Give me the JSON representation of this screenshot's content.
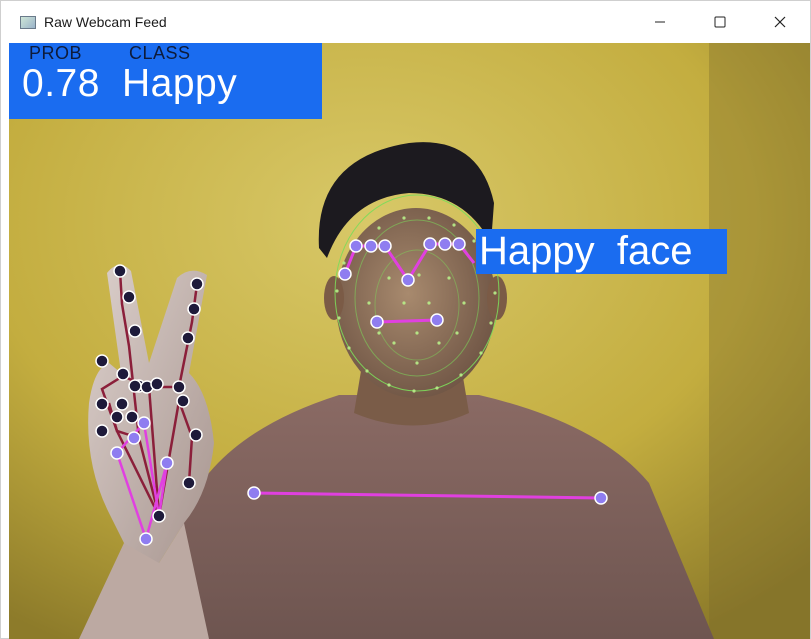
{
  "window": {
    "title": "Raw Webcam Feed",
    "app_icon": "webcam-app-icon",
    "controls": {
      "minimize_icon": "minimize-icon",
      "maximize_icon": "maximize-icon",
      "close_icon": "close-icon"
    }
  },
  "overlay": {
    "prob_header": "PROB",
    "class_header": "CLASS",
    "prob_value": "0.78",
    "class_value": "Happy",
    "face_label": "Happy  face",
    "box_color": "#1a6cf0",
    "landmark_color": "#e040e0",
    "mesh_color": "#7ddc5a",
    "hand_bone_color": "#8b1f3a"
  }
}
